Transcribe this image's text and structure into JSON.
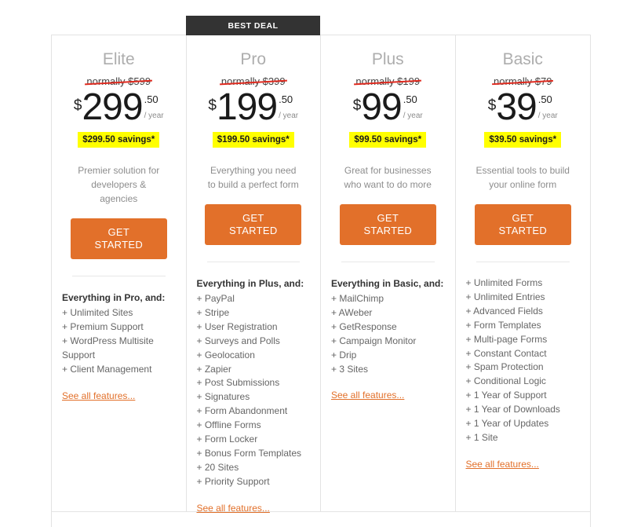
{
  "banner": {
    "label": "BEST DEAL"
  },
  "currency_symbol": "$",
  "cents_suffix": ".50",
  "period_label": "/ year",
  "cta_label": "GET STARTED",
  "see_all_label": "See all features...",
  "colors": {
    "cta_orange": "#e2702a",
    "savings_yellow": "#ffff00",
    "strike_red": "#e02b20",
    "banner_dark": "#333333",
    "plan_name_gray": "#adadad",
    "border_gray": "#e3e3e3"
  },
  "plans": [
    {
      "name": "Elite",
      "normally": "normally $599",
      "price": "299",
      "cents": ".50",
      "savings": "$299.50 savings*",
      "tagline": "Premier solution for developers & agencies",
      "features_title": "Everything in Pro, and:",
      "features": [
        "+ Unlimited Sites",
        "+ Premium Support",
        "+ WordPress Multisite Support",
        "+ Client Management"
      ],
      "see_all": "See all features...",
      "best_deal": false
    },
    {
      "name": "Pro",
      "normally": "normally $399",
      "price": "199",
      "cents": ".50",
      "savings": "$199.50 savings*",
      "tagline": "Everything you need to build a perfect form",
      "features_title": "Everything in Plus, and:",
      "features": [
        "+ PayPal",
        "+ Stripe",
        "+ User Registration",
        "+ Surveys and Polls",
        "+ Geolocation",
        "+ Zapier",
        "+ Post Submissions",
        "+ Signatures",
        "+ Form Abandonment",
        "+ Offline Forms",
        "+ Form Locker",
        "+ Bonus Form Templates",
        "+ 20 Sites",
        "+ Priority Support"
      ],
      "see_all": "See all features...",
      "best_deal": true
    },
    {
      "name": "Plus",
      "normally": "normally $199",
      "price": "99",
      "cents": ".50",
      "savings": "$99.50 savings*",
      "tagline": "Great for businesses who want to do more",
      "features_title": "Everything in Basic, and:",
      "features": [
        "+ MailChimp",
        "+ AWeber",
        "+ GetResponse",
        "+ Campaign Monitor",
        "+ Drip",
        "+ 3 Sites"
      ],
      "see_all": "See all features...",
      "best_deal": false
    },
    {
      "name": "Basic",
      "normally": "normally $79",
      "price": "39",
      "cents": ".50",
      "savings": "$39.50 savings*",
      "tagline": "Essential tools to build your online form",
      "features_title": "",
      "features": [
        "+ Unlimited Forms",
        "+ Unlimited Entries",
        "+ Advanced Fields",
        "+ Form Templates",
        "+ Multi-page Forms",
        "+ Constant Contact",
        "+ Spam Protection",
        "+ Conditional Logic",
        "+ 1 Year of Support",
        "+ 1 Year of Downloads",
        "+ 1 Year of Updates",
        "+ 1 Site"
      ],
      "see_all": "See all features...",
      "best_deal": false
    }
  ]
}
